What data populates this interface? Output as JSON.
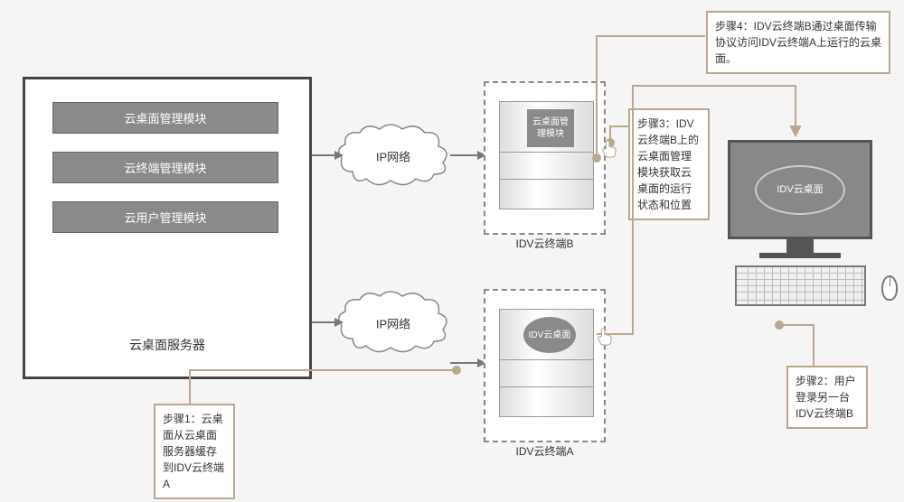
{
  "server": {
    "label": "云桌面服务器",
    "modules": {
      "m1": "云桌面管理模块",
      "m2": "云终端管理模块",
      "m3": "云用户管理模块"
    }
  },
  "clouds": {
    "c1": "IP网络",
    "c2": "IP网络"
  },
  "terminals": {
    "a": {
      "label": "IDV云终端A",
      "badge": "IDV云桌面"
    },
    "b": {
      "label": "IDV云终端B",
      "badge": "云桌面管理模块"
    }
  },
  "pc": {
    "screen": "IDV云桌面"
  },
  "notes": {
    "n4": "步骤4：IDV云终端B通过桌面传输协议访问IDV云终端A上运行的云桌面。",
    "n3": "步骤3：IDV云终端B上的云桌面管理模块获取云桌面的运行状态和位置",
    "n2": "步骤2：用户登录另一台IDV云终端B",
    "n1": "步骤1：云桌面从云桌面服务器缓存到IDV云终端A"
  }
}
